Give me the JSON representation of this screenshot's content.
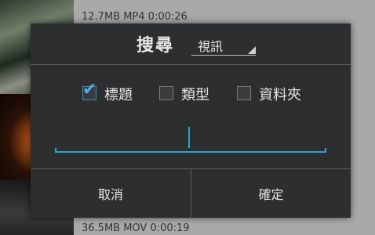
{
  "background_list": {
    "item1_meta": "12.7MB  MP4  0:00:26",
    "item2_meta": "36.5MB  MOV  0:00:19"
  },
  "dialog": {
    "title": "搜尋",
    "type_spinner": {
      "selected": "視訊"
    },
    "checkboxes": [
      {
        "label": "標題",
        "checked": true
      },
      {
        "label": "類型",
        "checked": false
      },
      {
        "label": "資料夾",
        "checked": false
      }
    ],
    "search_input": {
      "value": ""
    },
    "buttons": {
      "cancel": "取消",
      "ok": "確定"
    }
  },
  "colors": {
    "accent": "#2ea3d8",
    "dialog_bg": "#2d2e30"
  }
}
